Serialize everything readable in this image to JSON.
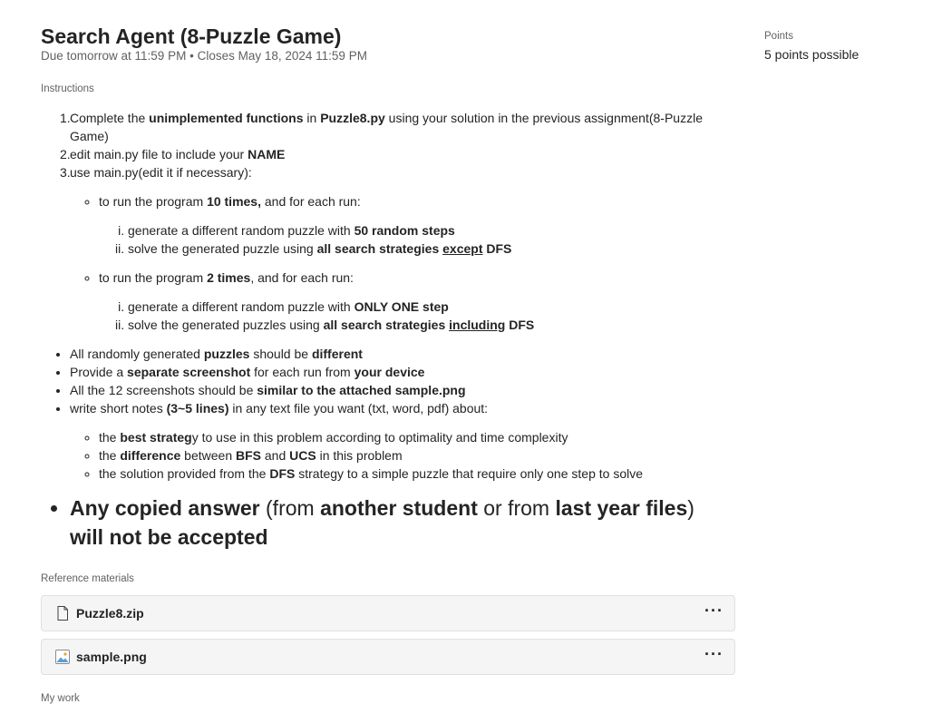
{
  "assignment": {
    "title": "Search Agent (8-Puzzle Game)",
    "due": "Due tomorrow at 11:59 PM",
    "separator": "•",
    "closes": "Closes May 18, 2024 11:59 PM"
  },
  "instructions": {
    "label": "Instructions",
    "steps": [
      {
        "num": "1.",
        "a": "Complete the ",
        "b": "unimplemented functions",
        "c": " in ",
        "d": "Puzzle8.py",
        "e": " using your solution in the previous assignment(8-Puzzle Game)"
      },
      {
        "num": "2.",
        "a": "edit main.py file to include your ",
        "b": "NAME"
      },
      {
        "num": "3.",
        "a": "use main.py(edit it if necessary):"
      }
    ],
    "run10": {
      "a": "to run the program ",
      "b": "10 times,",
      "c": " and for each run:"
    },
    "run10_items": [
      {
        "a": "generate a different random puzzle with ",
        "b": "50 random steps"
      },
      {
        "a": "solve the generated puzzle using ",
        "b": "all search strategies ",
        "u": "except",
        "c": " DFS"
      }
    ],
    "run2": {
      "a": "to run the program ",
      "b": "2 times",
      "c": ", and for each run:"
    },
    "run2_items": [
      {
        "a": "generate a different random puzzle with ",
        "b": "ONLY ONE step"
      },
      {
        "a": "solve the generated puzzles using ",
        "b": "all search strategies ",
        "u": "including",
        "c": " DFS"
      }
    ],
    "bullets": [
      {
        "a": "All randomly generated ",
        "b": "puzzles",
        "c": " should be ",
        "d": "different"
      },
      {
        "a": "Provide a ",
        "b": "separate screenshot",
        "c": " for each run from ",
        "d": "your device"
      },
      {
        "a": "All the 12 screenshots should be ",
        "b": "similar to the attached sample.png"
      },
      {
        "a": "write short notes ",
        "b": "(3~5 lines)",
        "c": " in any text file you want (txt, word, pdf) about:"
      }
    ],
    "notes": [
      {
        "a": "the ",
        "b": "best strateg",
        "c": "y to use in this problem according to optimality and time complexity"
      },
      {
        "a": "the ",
        "b": "difference",
        "c": " between ",
        "d": "BFS",
        "e": " and ",
        "f": "UCS",
        "g": " in this problem"
      },
      {
        "a": "the solution provided from the ",
        "b": "DFS",
        "c": " strategy to a simple puzzle that require only one step to solve"
      }
    ],
    "warning": {
      "a": "Any copied answer",
      "b": " (from ",
      "c": "another student",
      "d": " or from ",
      "e": "last year files",
      "f": ")",
      "g": "will not be accepted"
    }
  },
  "reference": {
    "label": "Reference materials",
    "files": [
      {
        "name": "Puzzle8.zip",
        "icon": "file-icon",
        "more": "···"
      },
      {
        "name": "sample.png",
        "icon": "image-icon",
        "more": "···"
      }
    ]
  },
  "points": {
    "label": "Points",
    "value": "5 points possible"
  },
  "next_section_label": "My work"
}
